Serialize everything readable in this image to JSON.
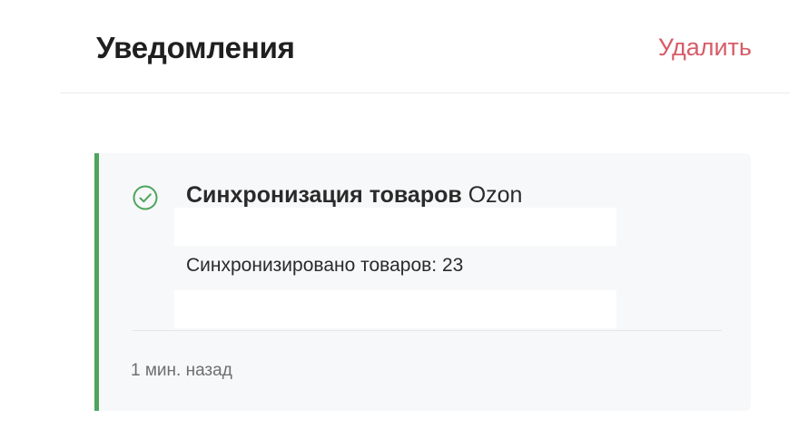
{
  "header": {
    "title": "Уведомления",
    "delete_label": "Удалить"
  },
  "notification": {
    "status_icon": "check-circle-icon",
    "title_bold": "Синхронизация товаров",
    "title_rest": "Ozon",
    "message": "Синхронизировано товаров: 23",
    "time": "1 мин. назад",
    "accent_color": "#4ea45c"
  },
  "colors": {
    "delete": "#d65c68",
    "card_background": "#f7f8fa",
    "success": "#4ea45c"
  }
}
